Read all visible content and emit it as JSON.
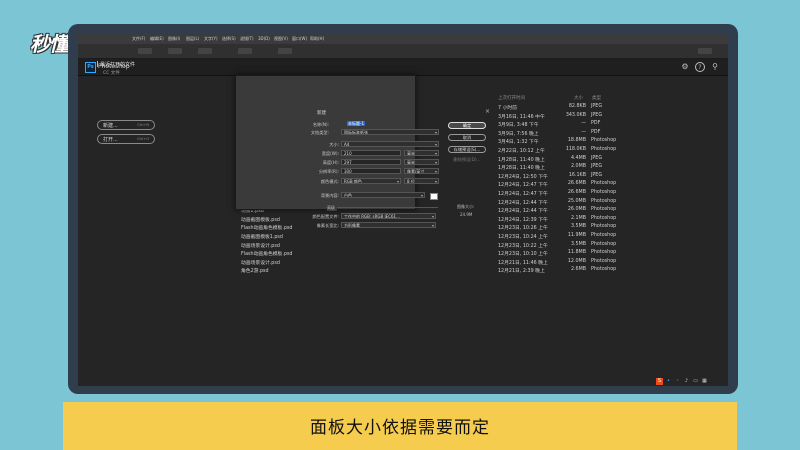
{
  "watermark": "秒懂视频",
  "menubar": {
    "items": [
      "文件(F)",
      "编辑(E)",
      "图像(I)",
      "图层(L)",
      "文字(Y)",
      "选择(S)",
      "滤镜(T)",
      "3D(D)",
      "视图(V)",
      "窗口(W)",
      "帮助(H)"
    ]
  },
  "app": {
    "logo": "Ps",
    "title": "Photoshop"
  },
  "icons": {
    "top": [
      "gear-icon",
      "help-icon",
      "search-icon"
    ],
    "view": [
      "list-view-icon",
      "grid-view-icon"
    ]
  },
  "sidebar": {
    "title": "最近打开的文件",
    "subtitle": "CC 文件",
    "new_button": {
      "label": "新建...",
      "shortcut": "Ctrl+N"
    },
    "open_button": {
      "label": "打开...",
      "shortcut": "Ctrl+O"
    }
  },
  "list": {
    "headers": {
      "name": "名称",
      "date": "上次打开时间",
      "size": "大小",
      "type": "类型"
    },
    "rows": [
      {
        "name": "0ring.jpg",
        "date": "7 小时前",
        "size": "82.8KB",
        "type": "JPEG"
      },
      {
        "name": "微信图片_20190201214429.jpg",
        "date": "3月16日, 11:46 中午",
        "size": "343.0KB",
        "type": "JPEG"
      },
      {
        "name": "1.pdf",
        "date": "3月9日, 3:48 下午",
        "size": "—",
        "type": "PDF"
      },
      {
        "name": "的频声反馈（第5版）（怀童）",
        "date": "3月9日, 7:56 晚上",
        "size": "—",
        "type": "PDF"
      },
      {
        "name": "58466fbdbd7fd.psd",
        "date": "3月4日, 1:32 下午",
        "size": "18.8MB",
        "type": "Photoshop"
      },
      {
        "name": "未标题-1.psd",
        "date": "2月22日, 10:12 上午",
        "size": "118.0KB",
        "type": "Photoshop"
      },
      {
        "name": "微信图片_20190120235353.jpg",
        "date": "1月28日, 11:40 晚上",
        "size": "4.4MB",
        "type": "JPEG"
      },
      {
        "name": "微信图片_20190120235353.jpg",
        "date": "1月28日, 11:40 晚上",
        "size": "2.0MB",
        "type": "JPEG"
      },
      {
        "name": "123.jpg",
        "date": "12月24日, 12:50 下午",
        "size": "16.1KB",
        "type": "JPEG"
      },
      {
        "name": "动画截图模板12.psd",
        "date": "12月24日, 12:47 下午",
        "size": "26.6MB",
        "type": "Photoshop"
      },
      {
        "name": "动画截图模板.psd",
        "date": "12月24日, 12:47 下午",
        "size": "26.6MB",
        "type": "Photoshop"
      },
      {
        "name": "场景3.psd",
        "date": "12月24日, 12:44 下午",
        "size": "25.0MB",
        "type": "Photoshop"
      },
      {
        "name": "场景2.psd",
        "date": "12月24日, 12:44 下午",
        "size": "26.0MB",
        "type": "Photoshop"
      },
      {
        "name": "动画截图模板.psd",
        "date": "12月24日, 12:39 下午",
        "size": "2.1MB",
        "type": "Photoshop"
      },
      {
        "name": "Flash动画角色模板.psd",
        "date": "12月23日, 10:26 上午",
        "size": "3.5MB",
        "type": "Photoshop"
      },
      {
        "name": "动画截图模板1.psd",
        "date": "12月23日, 10:24 上午",
        "size": "11.9MB",
        "type": "Photoshop"
      },
      {
        "name": "动画场景设计.psd",
        "date": "12月23日, 10:22 上午",
        "size": "3.5MB",
        "type": "Photoshop"
      },
      {
        "name": "Flash动画角色模板.psd",
        "date": "12月23日, 10:10 上午",
        "size": "11.8MB",
        "type": "Photoshop"
      },
      {
        "name": "动画场景设计.psd",
        "date": "12月21日, 11:46 晚上",
        "size": "12.0MB",
        "type": "Photoshop"
      },
      {
        "name": "角色2游.psd",
        "date": "12月21日, 2:39 晚上",
        "size": "2.6MB",
        "type": "Photoshop"
      }
    ]
  },
  "dialog": {
    "title": "新建",
    "close": "×",
    "fields": {
      "name": {
        "label": "名称(N):",
        "value": "未标题-1"
      },
      "preset": {
        "label": "文档类型:",
        "value": "国际标准纸张"
      },
      "size": {
        "label": "大小:",
        "value": "A4"
      },
      "width": {
        "label": "宽度(W):",
        "value": "210",
        "unit": "毫米"
      },
      "height": {
        "label": "高度(H):",
        "value": "297",
        "unit": "毫米"
      },
      "resolution": {
        "label": "分辨率(R):",
        "value": "300",
        "unit": "像素/英寸"
      },
      "color_mode": {
        "label": "颜色模式:",
        "value": "RGB 颜色",
        "depth": "8 位"
      },
      "background": {
        "label": "背景内容:",
        "value": "白色"
      }
    },
    "advanced": {
      "label": "高级",
      "color_profile": {
        "label": "颜色配置文件:",
        "value": "工作中的 RGB: sRGB IEC61..."
      },
      "pixel_aspect": {
        "label": "像素长宽比:",
        "value": "方形像素"
      }
    },
    "buttons": {
      "ok": "确定",
      "cancel": "取消",
      "save_preset": "存储预设(S)...",
      "delete_preset": "删除预设(D)..."
    },
    "image_size": {
      "label": "图像大小:",
      "value": "24.9M"
    }
  },
  "subtitle": "面板大小依据需要而定"
}
